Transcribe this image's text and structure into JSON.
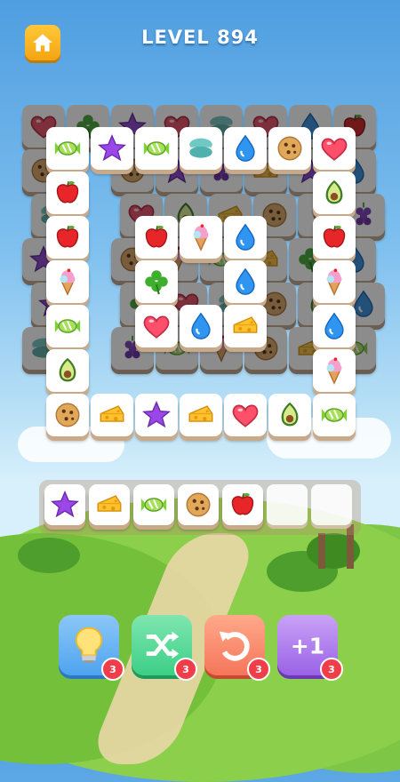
{
  "header": {
    "level_label": "LEVEL 894",
    "home_icon": "home-icon"
  },
  "colors": {
    "home": "#f7b21d",
    "hint": "#4ea4ef",
    "shuffle": "#3ccf86",
    "undo": "#f5765a",
    "plus": "#9a62e6",
    "badge": "#ef3d4a"
  },
  "board": {
    "back": [
      "heart",
      "clover",
      "star",
      "heart",
      "macaron",
      "heart",
      "water",
      "apple",
      "cookie",
      "cookie",
      "star",
      "grape",
      "cheese",
      "star",
      "water",
      "macaron",
      "heart",
      "avocado",
      "cheese",
      "cookie",
      "icecream",
      "grape",
      "star",
      "cookie",
      "icecream",
      "candy",
      "cheese",
      "clover",
      "water",
      "star",
      "clover",
      "heart",
      "macaron",
      "cookie",
      "avocado",
      "water",
      "macaron",
      "grape",
      "candy",
      "icecream",
      "cookie",
      "cheese",
      "candy"
    ],
    "front": [
      {
        "icon": "candy"
      },
      {
        "icon": "star"
      },
      {
        "icon": "candy"
      },
      {
        "icon": "macaron"
      },
      {
        "icon": "water"
      },
      {
        "icon": "cookie"
      },
      {
        "icon": "heart"
      },
      {
        "icon": "apple"
      },
      {
        "icon": "avocado"
      },
      {
        "icon": "apple"
      },
      {
        "icon": "apple"
      },
      {
        "icon": "icecream"
      },
      {
        "icon": "water"
      },
      {
        "icon": "apple"
      },
      {
        "icon": "icecream"
      },
      {
        "icon": "clover"
      },
      {
        "icon": "water"
      },
      {
        "icon": "icecream"
      },
      {
        "icon": "candy"
      },
      {
        "icon": "heart"
      },
      {
        "icon": "water"
      },
      {
        "icon": "cheese"
      },
      {
        "icon": "water"
      },
      {
        "icon": "avocado"
      },
      {
        "icon": "icecream"
      },
      {
        "icon": "cookie"
      },
      {
        "icon": "cheese"
      },
      {
        "icon": "star"
      },
      {
        "icon": "cheese"
      },
      {
        "icon": "heart"
      },
      {
        "icon": "avocado"
      },
      {
        "icon": "candy"
      }
    ]
  },
  "tray": {
    "slots": 7,
    "items": [
      "star",
      "cheese",
      "candy",
      "cookie",
      "apple"
    ]
  },
  "tools": [
    {
      "name": "hint-button",
      "icon": "lightbulb-icon",
      "count": "3"
    },
    {
      "name": "shuffle-button",
      "icon": "shuffle-icon",
      "count": "3"
    },
    {
      "name": "undo-button",
      "icon": "undo-icon",
      "count": "3"
    },
    {
      "name": "add-slot-button",
      "icon": "plus-one-icon",
      "label": "+1",
      "count": "3"
    }
  ]
}
